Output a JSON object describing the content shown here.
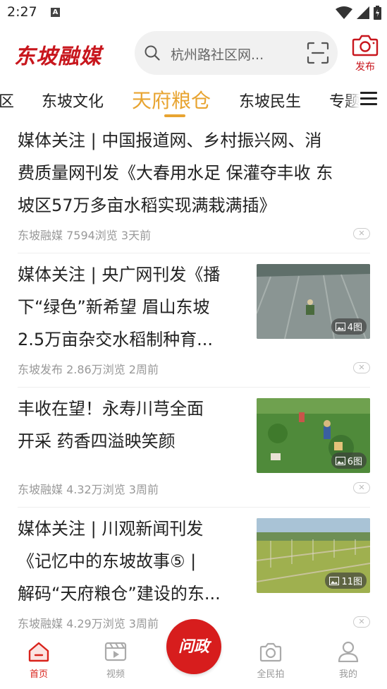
{
  "status": {
    "time": "2:27",
    "notif": "A"
  },
  "header": {
    "logo": "东坡融媒",
    "search_placeholder": "杭州路社区网...",
    "publish_label": "发布"
  },
  "tabs": [
    {
      "label": "区"
    },
    {
      "label": "东坡文化"
    },
    {
      "label": "天府粮仓"
    },
    {
      "label": "东坡民生"
    },
    {
      "label": "专题"
    }
  ],
  "articles": [
    {
      "title_lines": [
        "媒体关注 | 中国报道网、乡村振兴网、消",
        "费质量网刊发《大春用水足 保灌夺丰收 东",
        "坡区57万多亩水稻实现满栽满插》"
      ],
      "meta": "东坡融媒 7594浏览 3天前"
    },
    {
      "title_lines": [
        "媒体关注 | 央广网刊发《播",
        "下“绿色”新希望 眉山东坡",
        "2.5万亩杂交水稻制种育..."
      ],
      "meta": "东坡发布 2.86万浏览 2周前",
      "image_count": "4图"
    },
    {
      "title_lines": [
        "丰收在望！永寿川芎全面",
        "开采 药香四溢映笑颜"
      ],
      "meta": "东坡融媒 4.32万浏览 3周前",
      "image_count": "6图"
    },
    {
      "title_lines": [
        "媒体关注 | 川观新闻刊发",
        "《记忆中的东坡故事⑤ |",
        "解码“天府粮仓”建设的东..."
      ],
      "meta": "东坡融媒 4.29万浏览 3周前",
      "image_count": "11图"
    }
  ],
  "bottom_nav": {
    "home": "首页",
    "video": "视频",
    "center": "问政",
    "snap": "全民拍",
    "mine": "我的"
  },
  "colors": {
    "brand_red": "#c8161d",
    "tab_active": "#e8a431",
    "nav_active": "#d9231c"
  }
}
